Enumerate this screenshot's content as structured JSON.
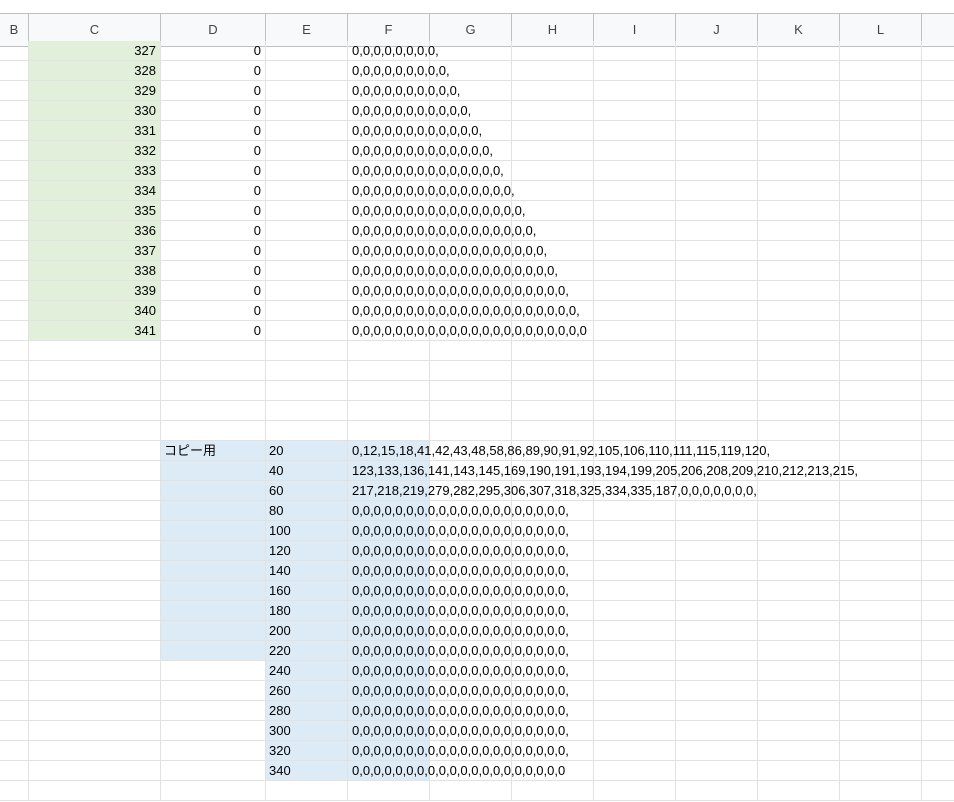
{
  "columns": [
    "B",
    "C",
    "D",
    "E",
    "F",
    "G",
    "H",
    "I",
    "J",
    "K",
    "L"
  ],
  "top_rows": [
    {
      "c": "327",
      "d": "0",
      "f": "0,0,0,0,0,0,0,0,"
    },
    {
      "c": "328",
      "d": "0",
      "f": "0,0,0,0,0,0,0,0,0,"
    },
    {
      "c": "329",
      "d": "0",
      "f": "0,0,0,0,0,0,0,0,0,0,"
    },
    {
      "c": "330",
      "d": "0",
      "f": "0,0,0,0,0,0,0,0,0,0,0,"
    },
    {
      "c": "331",
      "d": "0",
      "f": "0,0,0,0,0,0,0,0,0,0,0,0,"
    },
    {
      "c": "332",
      "d": "0",
      "f": "0,0,0,0,0,0,0,0,0,0,0,0,0,"
    },
    {
      "c": "333",
      "d": "0",
      "f": "0,0,0,0,0,0,0,0,0,0,0,0,0,0,"
    },
    {
      "c": "334",
      "d": "0",
      "f": "0,0,0,0,0,0,0,0,0,0,0,0,0,0,0,"
    },
    {
      "c": "335",
      "d": "0",
      "f": "0,0,0,0,0,0,0,0,0,0,0,0,0,0,0,0,"
    },
    {
      "c": "336",
      "d": "0",
      "f": "0,0,0,0,0,0,0,0,0,0,0,0,0,0,0,0,0,"
    },
    {
      "c": "337",
      "d": "0",
      "f": "0,0,0,0,0,0,0,0,0,0,0,0,0,0,0,0,0,0,"
    },
    {
      "c": "338",
      "d": "0",
      "f": "0,0,0,0,0,0,0,0,0,0,0,0,0,0,0,0,0,0,0,"
    },
    {
      "c": "339",
      "d": "0",
      "f": "0,0,0,0,0,0,0,0,0,0,0,0,0,0,0,0,0,0,0,0,"
    },
    {
      "c": "340",
      "d": "0",
      "f": "0,0,0,0,0,0,0,0,0,0,0,0,0,0,0,0,0,0,0,0,0,"
    },
    {
      "c": "341",
      "d": "0",
      "f": "0,0,0,0,0,0,0,0,0,0,0,0,0,0,0,0,0,0,0,0,0,0"
    }
  ],
  "copy_label": "コピー用",
  "copy_rows": [
    {
      "e": "20",
      "f": "0,12,15,18,41,42,43,48,58,86,89,90,91,92,105,106,110,111,115,119,120,"
    },
    {
      "e": "40",
      "f": "123,133,136,141,143,145,169,190,191,193,194,199,205,206,208,209,210,212,213,215,"
    },
    {
      "e": "60",
      "f": "217,218,219,279,282,295,306,307,318,325,334,335,187,0,0,0,0,0,0,0,"
    },
    {
      "e": "80",
      "f": "0,0,0,0,0,0,0,0,0,0,0,0,0,0,0,0,0,0,0,0,"
    },
    {
      "e": "100",
      "f": "0,0,0,0,0,0,0,0,0,0,0,0,0,0,0,0,0,0,0,0,"
    },
    {
      "e": "120",
      "f": "0,0,0,0,0,0,0,0,0,0,0,0,0,0,0,0,0,0,0,0,"
    },
    {
      "e": "140",
      "f": "0,0,0,0,0,0,0,0,0,0,0,0,0,0,0,0,0,0,0,0,"
    },
    {
      "e": "160",
      "f": "0,0,0,0,0,0,0,0,0,0,0,0,0,0,0,0,0,0,0,0,"
    },
    {
      "e": "180",
      "f": "0,0,0,0,0,0,0,0,0,0,0,0,0,0,0,0,0,0,0,0,"
    },
    {
      "e": "200",
      "f": "0,0,0,0,0,0,0,0,0,0,0,0,0,0,0,0,0,0,0,0,"
    },
    {
      "e": "220",
      "f": "0,0,0,0,0,0,0,0,0,0,0,0,0,0,0,0,0,0,0,0,"
    },
    {
      "e": "240",
      "f": "0,0,0,0,0,0,0,0,0,0,0,0,0,0,0,0,0,0,0,0,"
    },
    {
      "e": "260",
      "f": "0,0,0,0,0,0,0,0,0,0,0,0,0,0,0,0,0,0,0,0,"
    },
    {
      "e": "280",
      "f": "0,0,0,0,0,0,0,0,0,0,0,0,0,0,0,0,0,0,0,0,"
    },
    {
      "e": "300",
      "f": "0,0,0,0,0,0,0,0,0,0,0,0,0,0,0,0,0,0,0,0,"
    },
    {
      "e": "320",
      "f": "0,0,0,0,0,0,0,0,0,0,0,0,0,0,0,0,0,0,0,0,"
    },
    {
      "e": "340",
      "f": "0,0,0,0,0,0,0,0,0,0,0,0,0,0,0,0,0,0,0,0"
    }
  ],
  "colors": {
    "header_bg": "#f8f9fa",
    "grid_line": "#e2e2e2",
    "green_fill": "#e2efda",
    "blue_fill": "#ddebf7"
  }
}
